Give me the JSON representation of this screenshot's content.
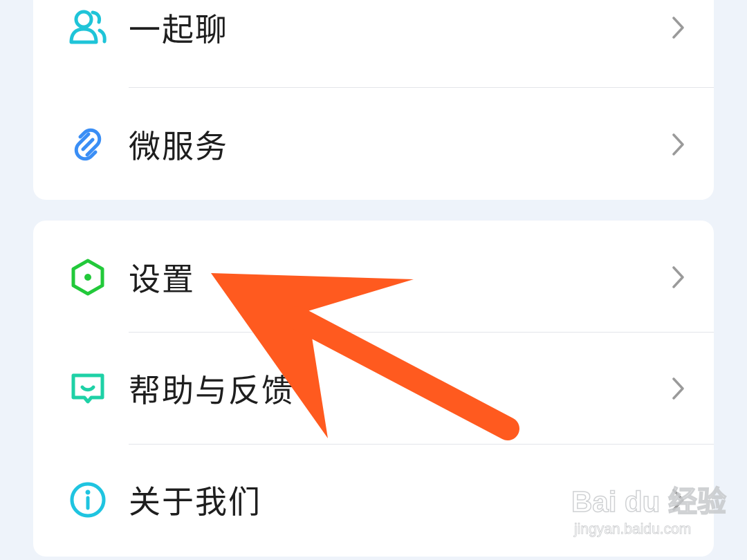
{
  "menu_group_1": [
    {
      "label": "一起聊",
      "icon": "people-icon",
      "color": "#1fc4d8"
    },
    {
      "label": "微服务",
      "icon": "link-icon",
      "color": "#3a8ef5"
    }
  ],
  "menu_group_2": [
    {
      "label": "设置",
      "icon": "hexagon-settings-icon",
      "color": "#22c93a"
    },
    {
      "label": "帮助与反馈",
      "icon": "feedback-chat-icon",
      "color": "#1ed1a6"
    },
    {
      "label": "关于我们",
      "icon": "info-icon",
      "color": "#1fc4e0"
    }
  ],
  "annotation": {
    "arrow_color": "#ff5a1f",
    "points_to": "设置"
  },
  "watermark": {
    "logo_text": "Bai du 经验",
    "url": "jingyan.baidu.com"
  }
}
